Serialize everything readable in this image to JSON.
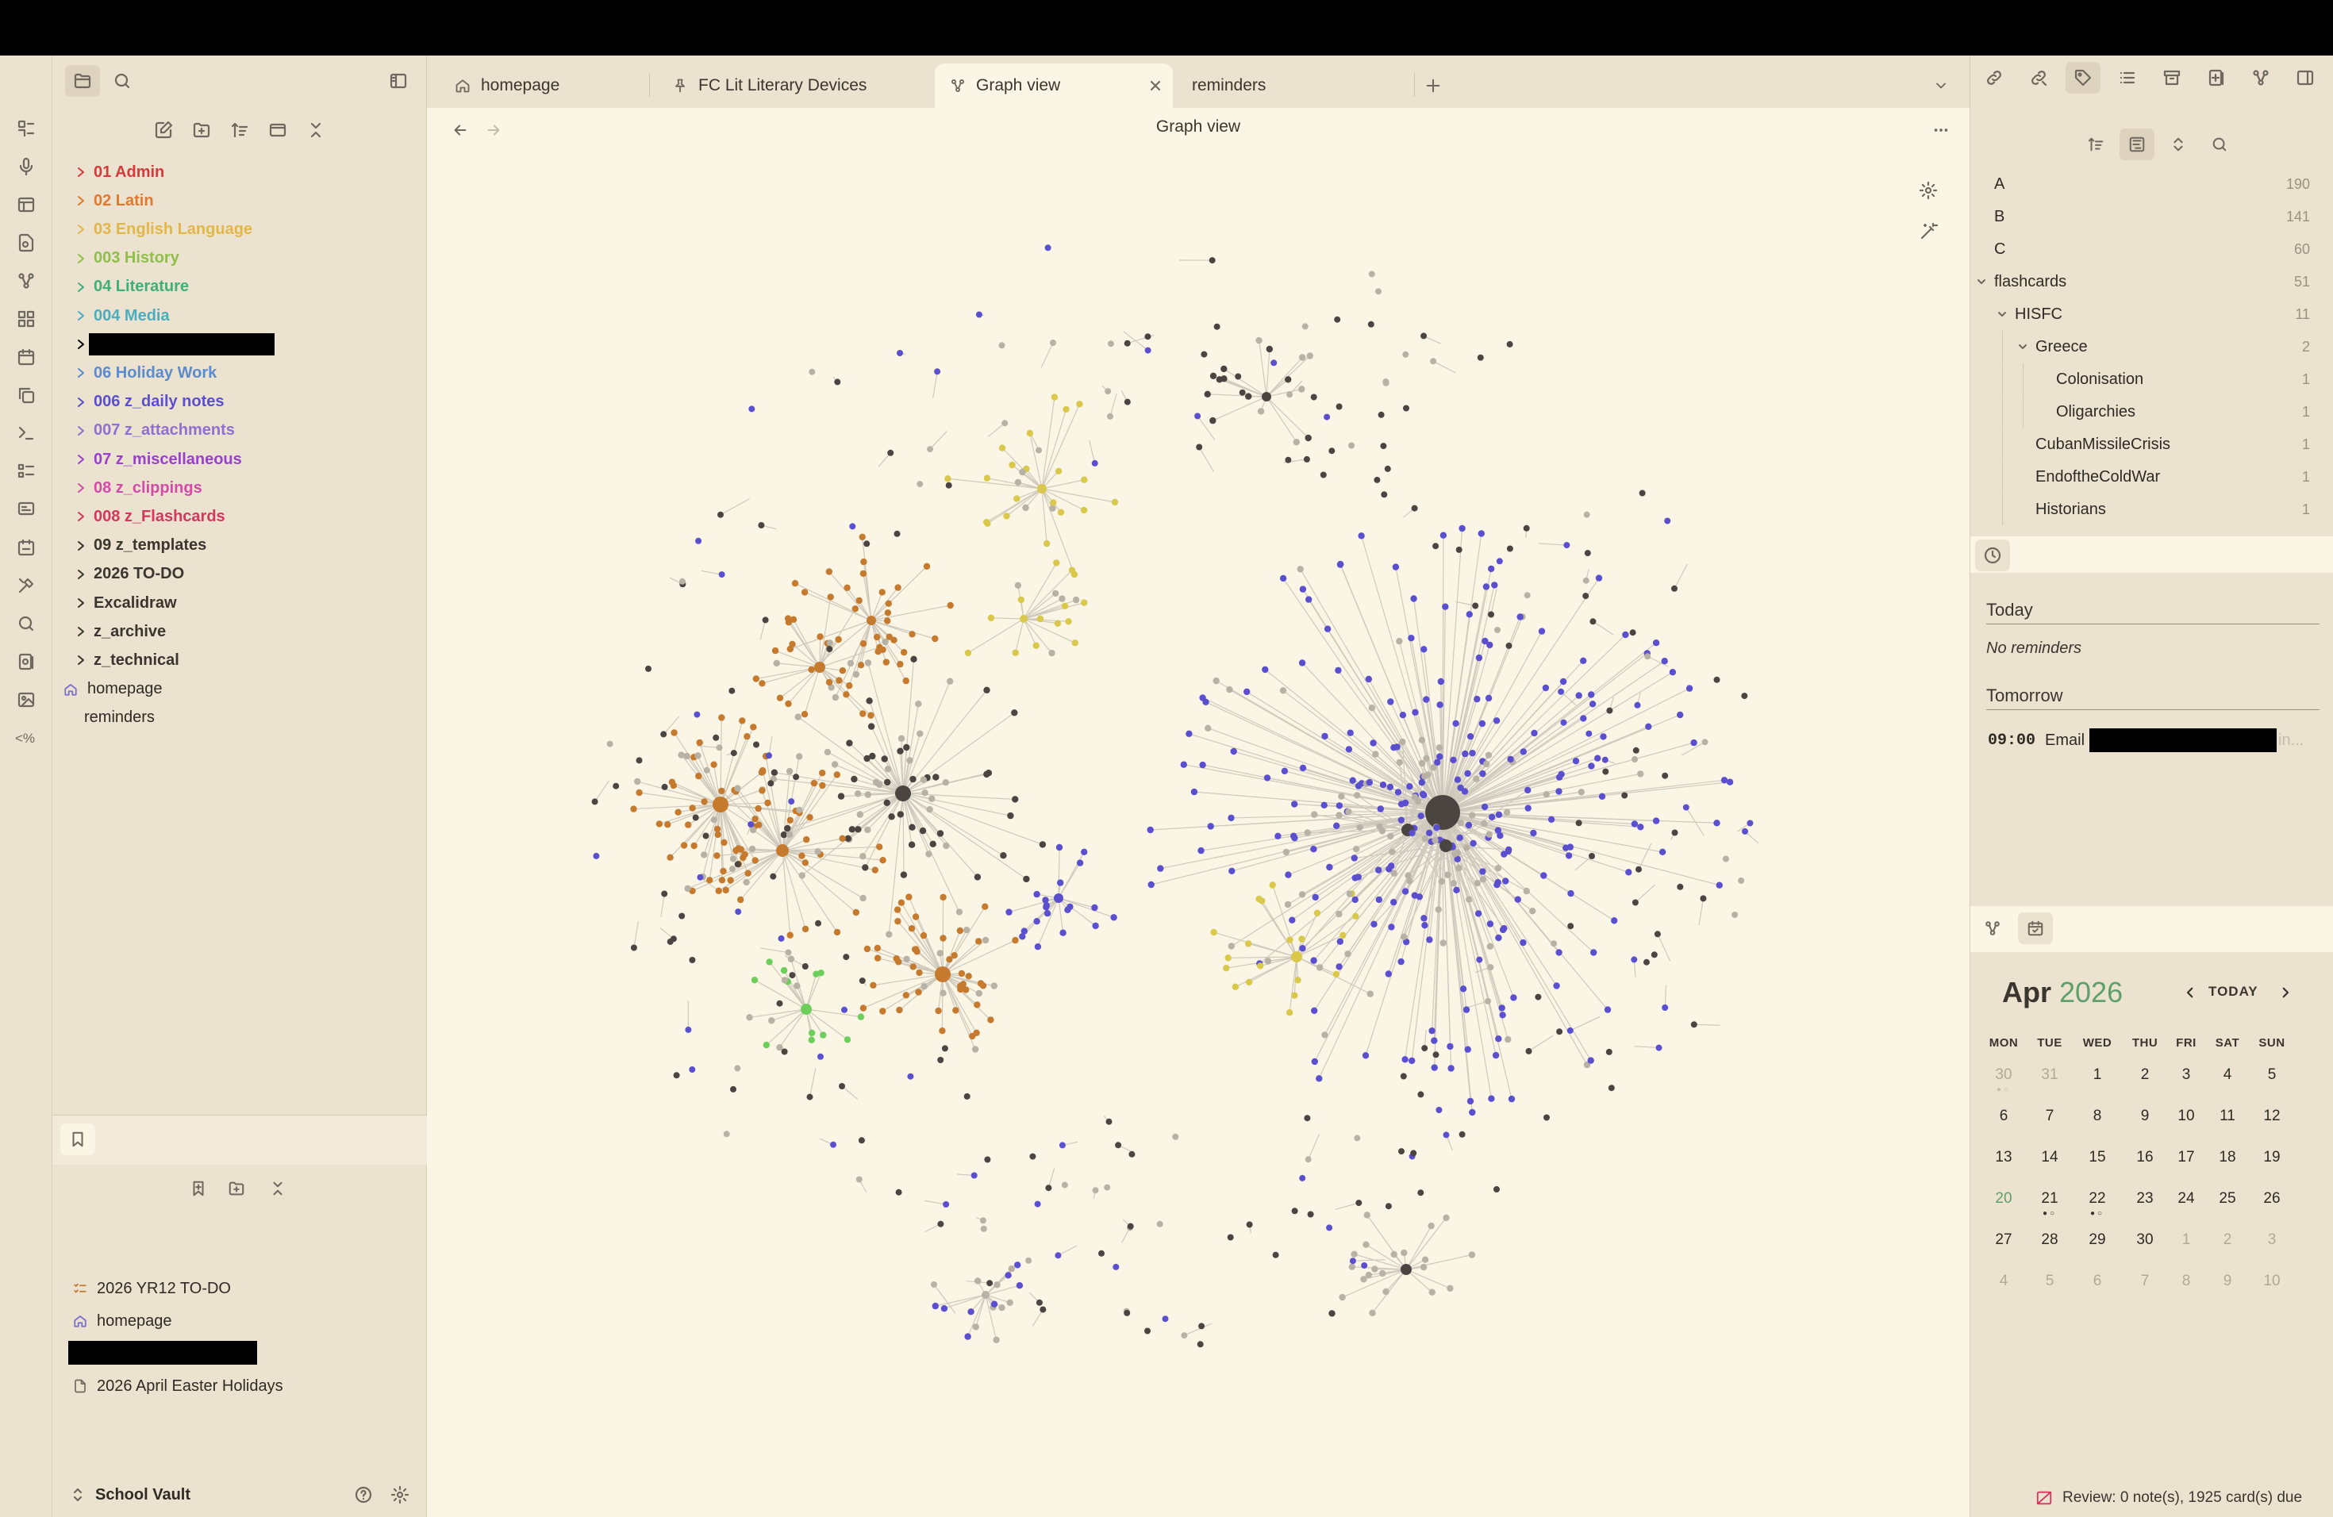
{
  "tabs": [
    {
      "label": "homepage",
      "icon": "home-icon",
      "active": false
    },
    {
      "label": "FC Lit Literary Devices",
      "icon": "pin-icon",
      "active": false
    },
    {
      "label": "Graph view",
      "icon": "graph-icon",
      "active": true
    },
    {
      "label": "reminders",
      "icon": "",
      "active": false
    }
  ],
  "main": {
    "title": "Graph view"
  },
  "file_tree": [
    {
      "label": "01 Admin",
      "color": "#d43a3a"
    },
    {
      "label": "02 Latin",
      "color": "#e07a2e"
    },
    {
      "label": "03 English Language",
      "color": "#e3b64a"
    },
    {
      "label": "003 History",
      "color": "#8fbf4a"
    },
    {
      "label": "04 Literature",
      "color": "#3fae7a"
    },
    {
      "label": "004 Media",
      "color": "#4aaec0"
    },
    {
      "label": "",
      "color": "#000000",
      "redacted": true
    },
    {
      "label": "06 Holiday Work",
      "color": "#5b8bcf"
    },
    {
      "label": "006 z_daily notes",
      "color": "#5a4fcf"
    },
    {
      "label": "007 z_attachments",
      "color": "#8f6fcf"
    },
    {
      "label": "07 z_miscellaneous",
      "color": "#9a3fd0"
    },
    {
      "label": "08 z_clippings",
      "color": "#d44aa8"
    },
    {
      "label": "008 z_Flashcards",
      "color": "#d4365e"
    },
    {
      "label": "09 z_templates",
      "color": "#3a352e"
    },
    {
      "label": "2026 TO-DO",
      "color": "#3a352e"
    },
    {
      "label": "Excalidraw",
      "color": "#3a352e"
    },
    {
      "label": "z_archive",
      "color": "#3a352e"
    },
    {
      "label": "z_technical",
      "color": "#3a352e"
    }
  ],
  "tree_files": [
    {
      "label": "homepage",
      "icon": "home-icon"
    },
    {
      "label": "reminders",
      "icon": ""
    }
  ],
  "bookmarks": [
    {
      "label": "2026 YR12 TO-DO",
      "icon": "checklist-icon"
    },
    {
      "label": "homepage",
      "icon": "home-icon"
    },
    {
      "label": "",
      "icon": "",
      "redacted": true
    },
    {
      "label": "2026 April Easter Holidays",
      "icon": "file-icon"
    }
  ],
  "vault": {
    "name": "School Vault"
  },
  "tags": [
    {
      "label": "A",
      "count": "190",
      "level": 0,
      "chev": false
    },
    {
      "label": "B",
      "count": "141",
      "level": 0,
      "chev": false
    },
    {
      "label": "C",
      "count": "60",
      "level": 0,
      "chev": false
    },
    {
      "label": "flashcards",
      "count": "51",
      "level": 0,
      "chev": true
    },
    {
      "label": "HISFC",
      "count": "11",
      "level": 1,
      "chev": true
    },
    {
      "label": "Greece",
      "count": "2",
      "level": 2,
      "chev": true
    },
    {
      "label": "Colonisation",
      "count": "1",
      "level": 3,
      "chev": false
    },
    {
      "label": "Oligarchies",
      "count": "1",
      "level": 3,
      "chev": false
    },
    {
      "label": "CubanMissileCrisis",
      "count": "1",
      "level": 2,
      "chev": false
    },
    {
      "label": "EndoftheColdWar",
      "count": "1",
      "level": 2,
      "chev": false
    },
    {
      "label": "Historians",
      "count": "1",
      "level": 2,
      "chev": false
    }
  ],
  "reminders": {
    "today_label": "Today",
    "today_empty": "No reminders",
    "tomorrow_label": "Tomorrow",
    "item_time": "09:00",
    "item_text": "Email",
    "item_suffix": "in..."
  },
  "calendar": {
    "month": "Apr",
    "year": "2026",
    "today_button": "TODAY",
    "dow": [
      "MON",
      "TUE",
      "WED",
      "THU",
      "FRI",
      "SAT",
      "SUN"
    ],
    "weeks": [
      [
        "30",
        "31",
        "1",
        "2",
        "3",
        "4",
        "5"
      ],
      [
        "6",
        "7",
        "8",
        "9",
        "10",
        "11",
        "12"
      ],
      [
        "13",
        "14",
        "15",
        "16",
        "17",
        "18",
        "19"
      ],
      [
        "20",
        "21",
        "22",
        "23",
        "24",
        "25",
        "26"
      ],
      [
        "27",
        "28",
        "29",
        "30",
        "1",
        "2",
        "3"
      ],
      [
        "4",
        "5",
        "6",
        "7",
        "8",
        "9",
        "10"
      ]
    ],
    "today": "20",
    "accent": "#5fa06a"
  },
  "status_bar": {
    "review": "Review: 0 note(s), 1925 card(s) due"
  },
  "graph_colors": {
    "orange": "#c57a2e",
    "blue": "#5a4fcf",
    "yellow": "#d9c84a",
    "green": "#6ccf5a",
    "dark": "#4a4540",
    "grey": "#b8b2a6",
    "edge": "#cfc9bd"
  }
}
